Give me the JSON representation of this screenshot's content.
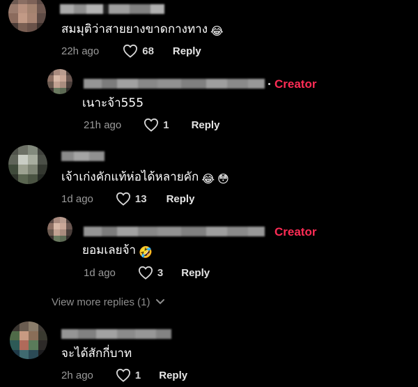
{
  "colors": {
    "background": "#000000",
    "creator": "#fe2c55",
    "meta_text": "#9a9a9a"
  },
  "comments": [
    {
      "text": "สมมุติว่าสายยางขาดกางทาง",
      "emoji": "😂",
      "time": "22h ago",
      "likes": "68",
      "reply": "Reply"
    },
    {
      "is_reply": true,
      "creator_label": "Creator",
      "text": "เนาะจ้า555",
      "time": "21h ago",
      "likes": "1",
      "reply": "Reply"
    },
    {
      "text": "เจ้าเก่งคักแท้ห่อได้หลายคัก",
      "emoji": "😂",
      "emoji2": "😳",
      "time": "1d ago",
      "likes": "13",
      "reply": "Reply"
    },
    {
      "is_reply": true,
      "creator_label": "Creator",
      "text": "ยอมเลยจ้า",
      "emoji": "🤣",
      "time": "1d ago",
      "likes": "3",
      "reply": "Reply"
    },
    {
      "text": "จะได้สักกี่บาท",
      "time": "2h ago",
      "likes": "1",
      "reply": "Reply"
    }
  ],
  "view_more": {
    "label": "View more replies (1)"
  },
  "icons": {
    "like": "heart-outline-icon",
    "expand": "chevron-down-icon"
  }
}
